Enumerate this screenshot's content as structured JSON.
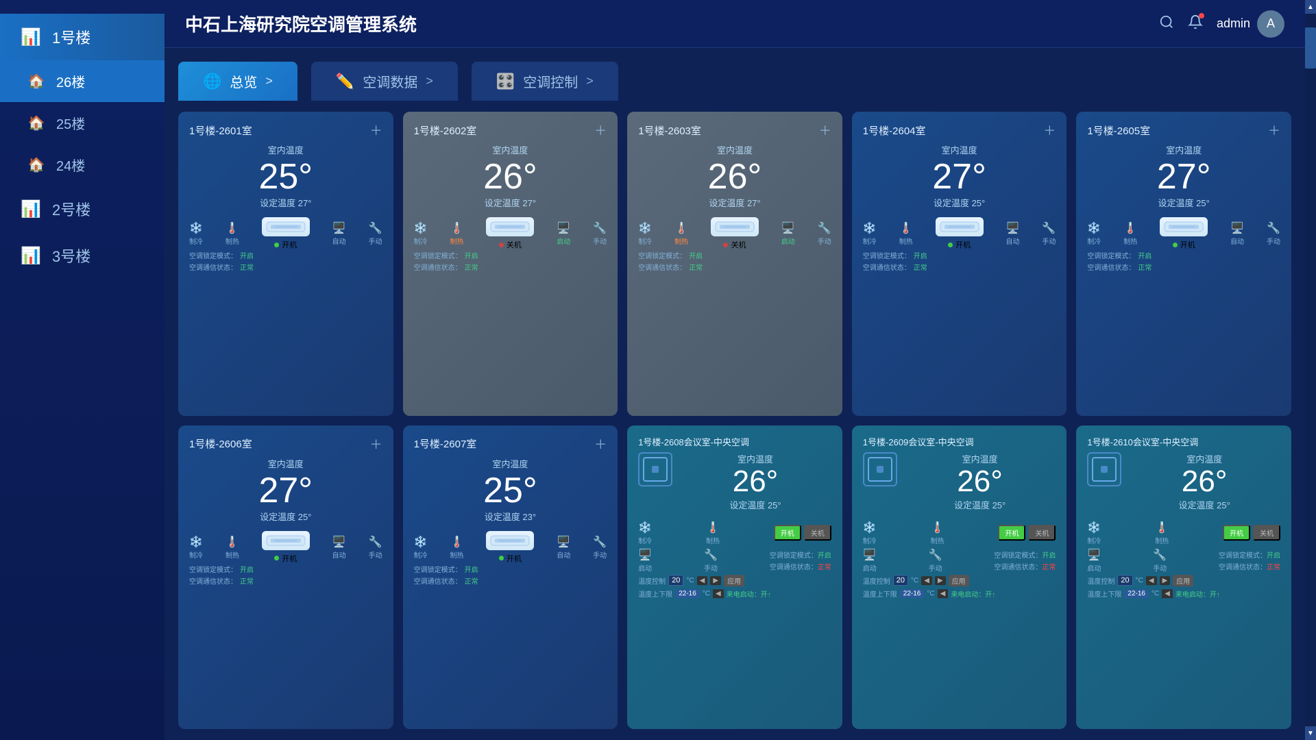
{
  "app": {
    "title": "中石上海研究院空调管理系统"
  },
  "header": {
    "title": "中石上海研究院空调管理系统",
    "user": "admin"
  },
  "nav": {
    "tabs": [
      {
        "id": "overview",
        "icon": "🌐",
        "label": "总览",
        "arrow": ">",
        "active": true
      },
      {
        "id": "data",
        "icon": "✏️",
        "label": "空调数据",
        "arrow": ">",
        "active": false
      },
      {
        "id": "control",
        "icon": "🎛️",
        "label": "空调控制",
        "arrow": ">",
        "active": false
      }
    ]
  },
  "sidebar": {
    "buildings": [
      {
        "id": "b1",
        "icon": "📊",
        "label": "1号楼",
        "active": true,
        "floors": [
          {
            "id": "f26",
            "label": "26楼",
            "active": true
          },
          {
            "id": "f25",
            "label": "25楼",
            "active": false
          },
          {
            "id": "f24",
            "label": "24楼",
            "active": false
          }
        ]
      },
      {
        "id": "b2",
        "icon": "📊",
        "label": "2号楼",
        "active": false
      },
      {
        "id": "b3",
        "icon": "📊",
        "label": "3号楼",
        "active": false
      }
    ]
  },
  "rooms": [
    {
      "id": "r2601",
      "title": "1号楼-2601室",
      "style": "blue",
      "temp": "25°",
      "setTemp": "设定温度 27°",
      "status": "on",
      "statusLabel": "开机",
      "mode": "制冷",
      "control": "自动",
      "lockMode": "空调锁定模式：开启",
      "commStatus": "空调通信状态：正常"
    },
    {
      "id": "r2602",
      "title": "1号楼-2602室",
      "style": "gray",
      "temp": "26°",
      "setTemp": "设定温度 27°",
      "status": "off",
      "statusLabel": "关机",
      "mode": "制热",
      "control": "手动",
      "lockMode": "空调锁定模式：开启",
      "commStatus": "空调通信状态：正常"
    },
    {
      "id": "r2603",
      "title": "1号楼-2603室",
      "style": "gray",
      "temp": "26°",
      "setTemp": "设定温度 27°",
      "status": "off",
      "statusLabel": "关机",
      "mode": "制热",
      "control": "手动",
      "lockMode": "空调锁定模式：开启",
      "commStatus": "空调通信状态：正常"
    },
    {
      "id": "r2604",
      "title": "1号楼-2604室",
      "style": "blue",
      "temp": "27°",
      "setTemp": "设定温度 25°",
      "status": "on",
      "statusLabel": "开机",
      "mode": "制冷",
      "control": "自动",
      "lockMode": "空调锁定模式：开启",
      "commStatus": "空调通信状态：正常"
    },
    {
      "id": "r2605",
      "title": "1号楼-2605室",
      "style": "blue",
      "temp": "27°",
      "setTemp": "设定温度 25°",
      "status": "on",
      "statusLabel": "开机",
      "mode": "制冷",
      "control": "自动",
      "lockMode": "空调锁定模式：开启",
      "commStatus": "空调通信状态：正常"
    },
    {
      "id": "r2606",
      "title": "1号楼-2606室",
      "style": "blue",
      "temp": "27°",
      "setTemp": "设定温度 25°",
      "status": "on",
      "statusLabel": "开机",
      "mode": "制冷",
      "control": "自动",
      "lockMode": "空调锁定模式：开启",
      "commStatus": "空调通信状态：正常"
    },
    {
      "id": "r2607",
      "title": "1号楼-2607室",
      "style": "blue",
      "temp": "25°",
      "setTemp": "设定温度 23°",
      "status": "on",
      "statusLabel": "开机",
      "mode": "制冷",
      "control": "自动",
      "lockMode": "空调锁定模式：开启",
      "commStatus": "空调通信状态：正常"
    },
    {
      "id": "r2608",
      "title": "1号楼-2608会议室-中央空调",
      "style": "teal",
      "temp": "26°",
      "setTemp": "设定温度 25°",
      "status": "on",
      "statusLabel": "开机",
      "mode": "制热",
      "control": "手动",
      "lockMode": "空调锁定模式：开启",
      "commStatus": "空调通信状态：正常",
      "central": true,
      "tempControl": "20",
      "tempRange": "22-16"
    },
    {
      "id": "r2609",
      "title": "1号楼-2609会议室-中央空调",
      "style": "teal",
      "temp": "26°",
      "setTemp": "设定温度 25°",
      "status": "on",
      "statusLabel": "开机",
      "mode": "制热",
      "control": "手动",
      "lockMode": "空调锁定模式：开启",
      "commStatus": "空调通信状态：正常",
      "central": true,
      "tempControl": "20",
      "tempRange": "22-16"
    },
    {
      "id": "r2610",
      "title": "1号楼-2610会议室-中央空调",
      "style": "teal",
      "temp": "26°",
      "setTemp": "设定温度 25°",
      "status": "on",
      "statusLabel": "开机",
      "mode": "制热",
      "control": "手动",
      "lockMode": "空调锁定模式：开启",
      "commStatus": "空调通信状态：正常",
      "central": true,
      "tempControl": "20",
      "tempRange": "22-16"
    }
  ],
  "labels": {
    "indoor_temp": "室内温度",
    "cooling": "制冷",
    "heating": "制热",
    "auto": "自动",
    "manual": "手动",
    "on": "开机",
    "off": "关机",
    "lock_mode_on": "空调锁定模式：开启",
    "comm_status_normal": "空调通信状态：正常",
    "temp_control": "温度控制",
    "temp_range": "温度上下限",
    "remote_start": "来电启动：开启"
  }
}
